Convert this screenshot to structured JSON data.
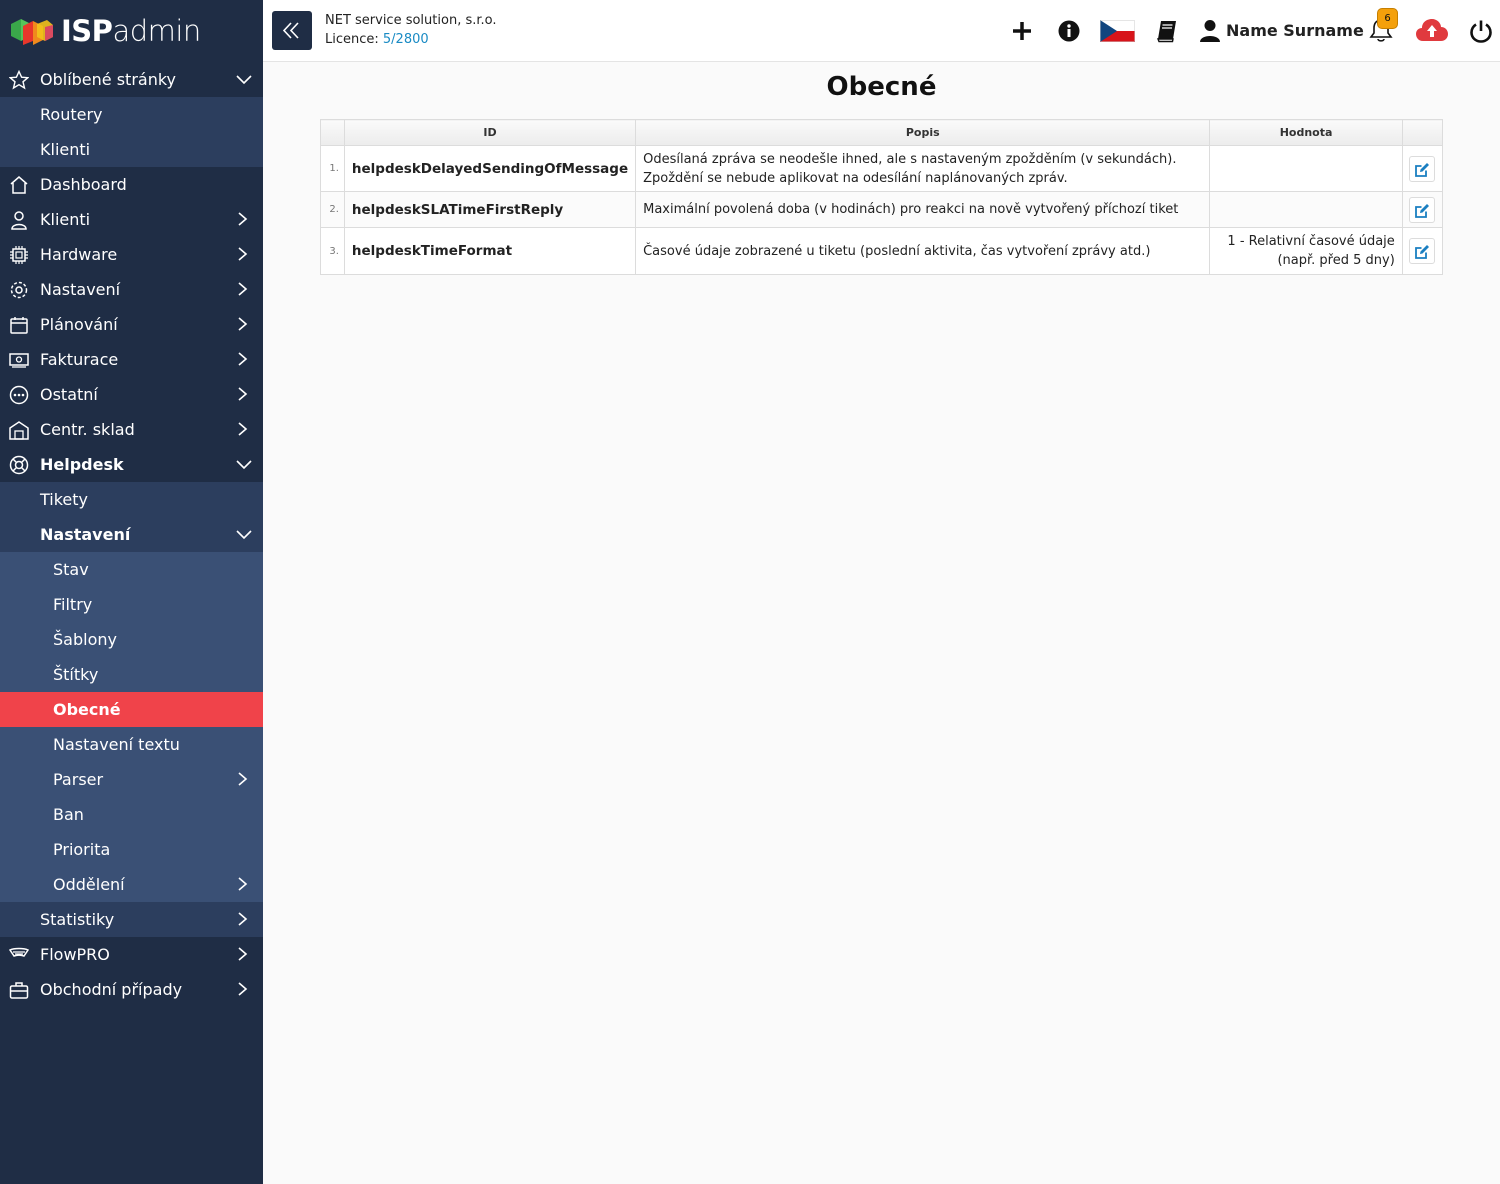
{
  "app": {
    "logo_bold": "ISP",
    "logo_light": "admin"
  },
  "sidebar": {
    "favorites": {
      "label": "Oblíbené stránky",
      "items": [
        {
          "label": "Routery"
        },
        {
          "label": "Klienti"
        }
      ]
    },
    "items": [
      {
        "label": "Dashboard"
      },
      {
        "label": "Klienti"
      },
      {
        "label": "Hardware"
      },
      {
        "label": "Nastavení"
      },
      {
        "label": "Plánování"
      },
      {
        "label": "Fakturace"
      },
      {
        "label": "Ostatní"
      },
      {
        "label": "Centr. sklad"
      }
    ],
    "helpdesk": {
      "label": "Helpdesk",
      "tickets": "Tikety",
      "settings": {
        "label": "Nastavení",
        "items": [
          {
            "label": "Stav"
          },
          {
            "label": "Filtry"
          },
          {
            "label": "Šablony"
          },
          {
            "label": "Štítky"
          },
          {
            "label": "Obecné"
          },
          {
            "label": "Nastavení textu"
          },
          {
            "label": "Parser"
          },
          {
            "label": "Ban"
          },
          {
            "label": "Priorita"
          },
          {
            "label": "Oddělení"
          }
        ]
      },
      "stats": "Statistiky"
    },
    "bottom": [
      {
        "label": "FlowPRO"
      },
      {
        "label": "Obchodní případy"
      }
    ]
  },
  "header": {
    "company": "NET service solution, s.r.o.",
    "licence_label": "Licence:",
    "licence_value": "5/2800",
    "user_name": "Name Surname",
    "notifications": "6"
  },
  "main": {
    "title": "Obecné",
    "table": {
      "columns": [
        "ID",
        "Popis",
        "Hodnota"
      ],
      "rows": [
        {
          "num": "1.",
          "id": "helpdeskDelayedSendingOfMessage",
          "desc": "Odesílaná zpráva se neodešle ihned, ale s nastaveným zpožděním (v sekundách). Zpoždění se nebude aplikovat na odesílání naplánovaných zpráv.",
          "value": ""
        },
        {
          "num": "2.",
          "id": "helpdeskSLATimeFirstReply",
          "desc": "Maximální povolená doba (v hodinách) pro reakci na nově vytvořený příchozí tiket",
          "value": ""
        },
        {
          "num": "3.",
          "id": "helpdeskTimeFormat",
          "desc": "Časové údaje zobrazené u tiketu (poslední aktivita, čas vytvoření zprávy atd.)",
          "value": "1 - Relativní časové údaje (např. před 5 dny)"
        }
      ]
    }
  },
  "colors": {
    "sidebar_bg": "#1f2d45",
    "sidebar_sub_bg": "#2c3e5e",
    "sidebar_sub2_bg": "#3a5075",
    "active": "#f0434a",
    "link": "#1a8bc4",
    "badge": "#f4a00b"
  }
}
